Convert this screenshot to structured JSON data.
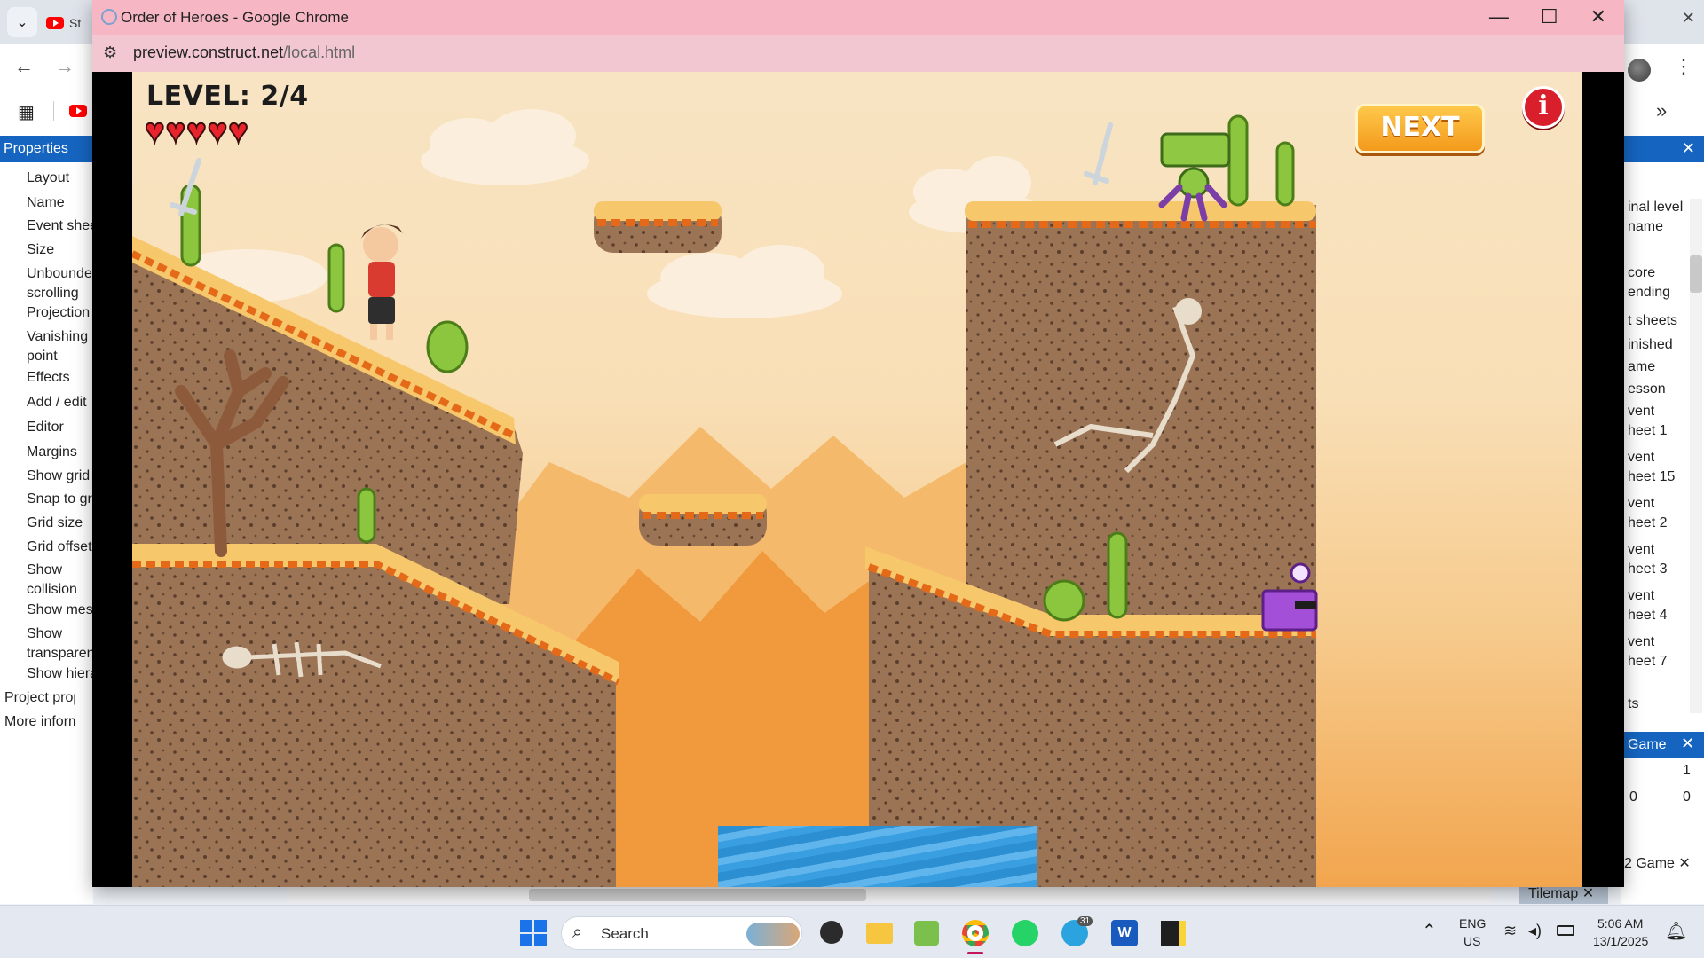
{
  "background_browser": {
    "tab_label": "St",
    "window_controls": [
      "—",
      "☐",
      "✕"
    ],
    "nav_back": "←",
    "nav_forward": "→",
    "overflow": "»"
  },
  "properties_panel": {
    "title": "Properties",
    "items": [
      {
        "label": "Layout",
        "kind": "cat"
      },
      {
        "label": "Name",
        "kind": "prop"
      },
      {
        "label": "Event shee",
        "kind": "prop"
      },
      {
        "label": "Size",
        "kind": "prop"
      },
      {
        "label": "Unbounded scrolling",
        "kind": "prop"
      },
      {
        "label": "Projection",
        "kind": "prop"
      },
      {
        "label": "Vanishing point",
        "kind": "prop"
      },
      {
        "label": "Effects",
        "kind": "cat"
      },
      {
        "label": "Add / edit",
        "kind": "prop"
      },
      {
        "label": "Editor",
        "kind": "cat"
      },
      {
        "label": "Margins",
        "kind": "prop"
      },
      {
        "label": "Show grid",
        "kind": "prop"
      },
      {
        "label": "Snap to gr",
        "kind": "prop"
      },
      {
        "label": "Grid size",
        "kind": "prop"
      },
      {
        "label": "Grid offset",
        "kind": "prop"
      },
      {
        "label": "Show collision polygons",
        "kind": "prop"
      },
      {
        "label": "Show mes",
        "kind": "prop"
      },
      {
        "label": "Show transparent inactive layers",
        "kind": "prop"
      },
      {
        "label": "Show hiera",
        "kind": "prop"
      },
      {
        "label": "Project prope",
        "kind": "root"
      },
      {
        "label": "More informa",
        "kind": "root"
      }
    ]
  },
  "right_panel": {
    "items": [
      "inal level name",
      "core ending",
      "t sheets",
      "inished",
      "ame",
      "esson",
      "vent heet 1",
      "vent heet 15",
      "vent heet 2",
      "vent heet 3",
      "vent heet 4",
      "vent heet 7",
      "ts"
    ],
    "game_panel_title": "Game",
    "value_1": "1",
    "value_2": "0",
    "value_3": "0",
    "tab_label": "2 Game"
  },
  "tilemap_tab": "Tilemap",
  "preview_window": {
    "title": "Order of Heroes - Google Chrome",
    "url_host": "preview.construct.net",
    "url_path": "/local.html",
    "window_controls": [
      "—",
      "☐",
      "✕"
    ]
  },
  "game": {
    "level_text": "LEVEL: 2/4",
    "hearts": 5,
    "next_label": "NEXT",
    "info_label": "i"
  },
  "taskbar": {
    "search_placeholder": "Search",
    "language": "ENG",
    "region": "US",
    "time": "5:06 AM",
    "date": "13/1/2025",
    "telegram_badge": "31",
    "apps": [
      "start-icon",
      "search-icon",
      "obs-icon",
      "file-explorer-icon",
      "paint-icon",
      "chrome-icon",
      "whatsapp-icon",
      "telegram-icon",
      "word-icon",
      "sticky-notes-icon"
    ]
  }
}
